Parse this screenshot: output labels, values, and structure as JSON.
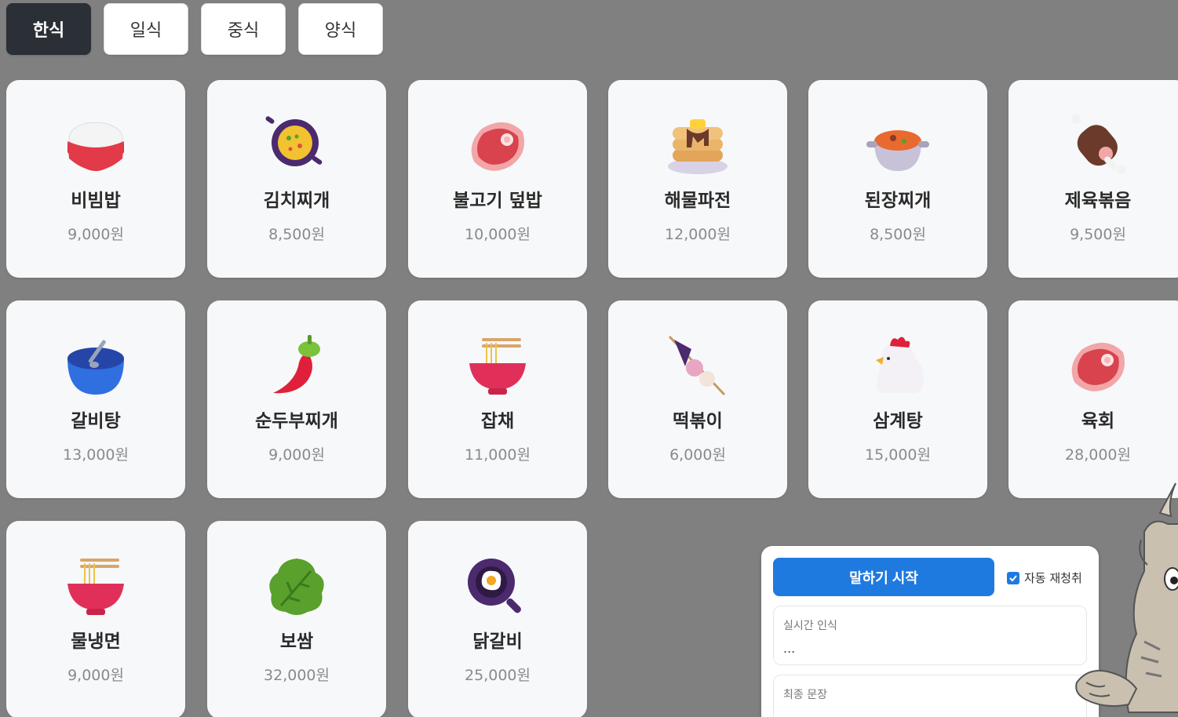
{
  "tabs": [
    {
      "label": "한식",
      "active": true
    },
    {
      "label": "일식",
      "active": false
    },
    {
      "label": "중식",
      "active": false
    },
    {
      "label": "양식",
      "active": false
    }
  ],
  "menu": [
    {
      "name": "비빔밥",
      "price": "9,000원",
      "icon": "rice-bowl-icon"
    },
    {
      "name": "김치찌개",
      "price": "8,500원",
      "icon": "paella-pan-icon"
    },
    {
      "name": "불고기 덮밥",
      "price": "10,000원",
      "icon": "meat-cut-icon"
    },
    {
      "name": "해물파전",
      "price": "12,000원",
      "icon": "pancakes-icon"
    },
    {
      "name": "된장찌개",
      "price": "8,500원",
      "icon": "stew-pot-icon"
    },
    {
      "name": "제육볶음",
      "price": "9,500원",
      "icon": "meat-on-bone-icon"
    },
    {
      "name": "갈비탕",
      "price": "13,000원",
      "icon": "bowl-with-spoon-icon"
    },
    {
      "name": "순두부찌개",
      "price": "9,000원",
      "icon": "hot-pepper-icon"
    },
    {
      "name": "잡채",
      "price": "11,000원",
      "icon": "noodle-bowl-icon"
    },
    {
      "name": "떡볶이",
      "price": "6,000원",
      "icon": "oden-skewer-icon"
    },
    {
      "name": "삼계탕",
      "price": "15,000원",
      "icon": "chicken-icon"
    },
    {
      "name": "육회",
      "price": "28,000원",
      "icon": "meat-cut-icon"
    },
    {
      "name": "물냉면",
      "price": "9,000원",
      "icon": "noodle-bowl-icon"
    },
    {
      "name": "보쌈",
      "price": "32,000원",
      "icon": "leafy-green-icon"
    },
    {
      "name": "닭갈비",
      "price": "25,000원",
      "icon": "frying-pan-egg-icon"
    }
  ],
  "voice": {
    "speak_label": "말하기 시작",
    "auto_listen_label": "자동 재청취",
    "auto_listen_checked": true,
    "realtime_label": "실시간 인식",
    "realtime_value": "...",
    "final_label": "최종 문장",
    "final_value": ""
  },
  "colors": {
    "background": "#808080",
    "active_tab": "#2b2f36",
    "primary": "#1f7ae0",
    "card": "#f7f8fa"
  }
}
